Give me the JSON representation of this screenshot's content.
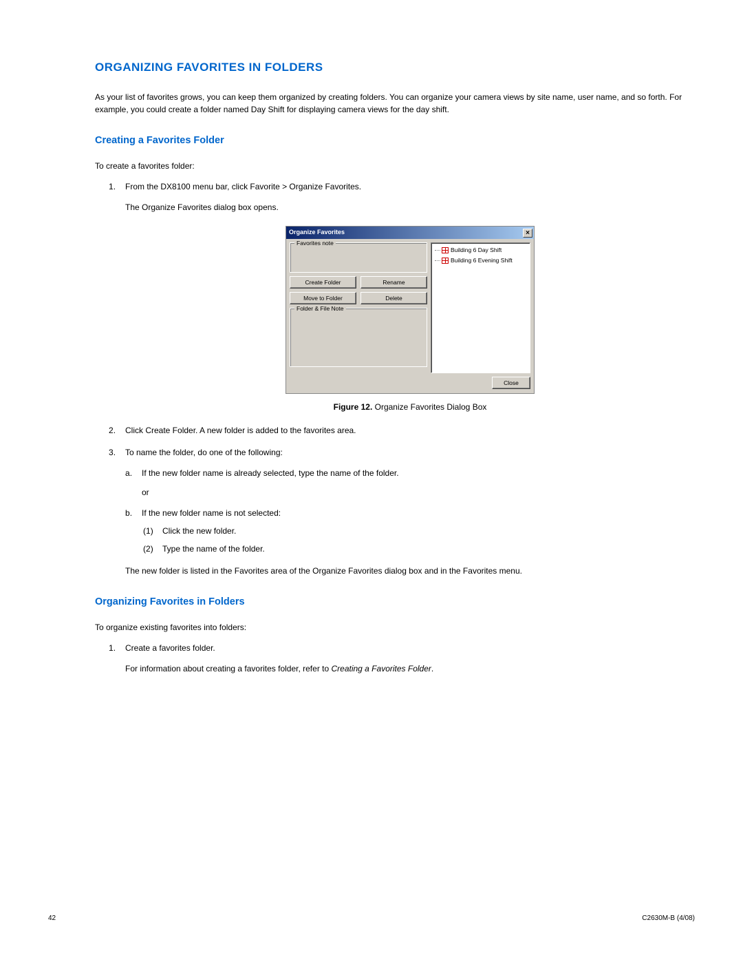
{
  "heading_main": "ORGANIZING FAVORITES IN FOLDERS",
  "intro": "As your list of favorites grows, you can keep them organized by creating folders. You can organize your camera views by site name, user name, and so forth. For example, you could create a folder named Day Shift for displaying camera views for the day shift.",
  "section_a": {
    "title": "Creating a Favorites Folder",
    "lead": "To create a favorites folder:",
    "step1": "From the DX8100 menu bar, click Favorite > Organize Favorites.",
    "step1_sub": "The Organize Favorites dialog box opens.",
    "step2": "Click Create Folder. A new folder is added to the favorites area.",
    "step3": "To name the folder, do one of the following:",
    "step3a": "If the new folder name is already selected, type the name of the folder.",
    "step3a_or": "or",
    "step3b": "If the new folder name is not selected:",
    "step3b1": "Click the new folder.",
    "step3b2": "Type the name of the folder.",
    "step3_end": "The new folder is listed in the Favorites area of the Organize Favorites dialog box and in the Favorites menu."
  },
  "figure": {
    "label_bold": "Figure 12.",
    "label_rest": "  Organize Favorites Dialog Box"
  },
  "dialog": {
    "title": "Organize Favorites",
    "favorites_note": "Favorites note",
    "btn_create": "Create Folder",
    "btn_rename": "Rename",
    "btn_move": "Move to Folder",
    "btn_delete": "Delete",
    "folder_file_note": "Folder & File Note",
    "btn_close": "Close",
    "tree": [
      "Building 6 Day Shift",
      "Building 6 Evening Shift"
    ]
  },
  "section_b": {
    "title": "Organizing Favorites in Folders",
    "lead": "To organize existing favorites into folders:",
    "step1": "Create a favorites folder.",
    "step1_sub_pre": "For information about creating a favorites folder, refer to ",
    "step1_sub_em": "Creating a Favorites Folder",
    "step1_sub_post": "."
  },
  "footer": {
    "page": "42",
    "doc": "C2630M-B (4/08)"
  }
}
